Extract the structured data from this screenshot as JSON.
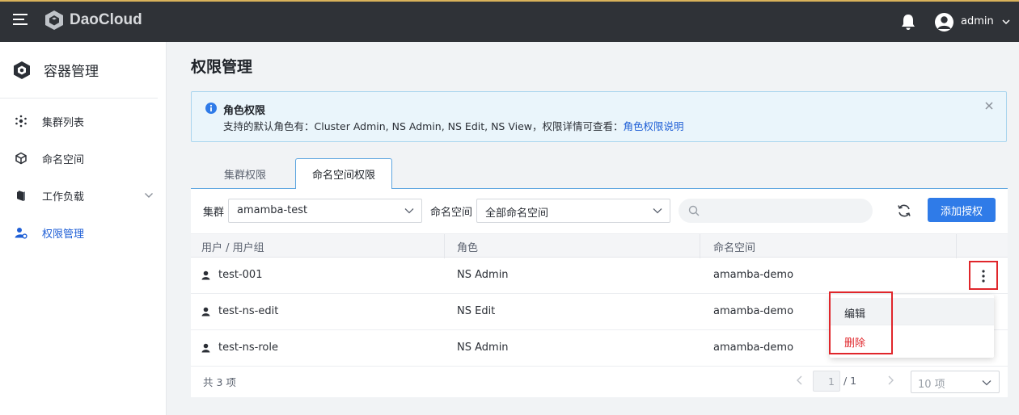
{
  "header": {
    "logo_text": "DaoCloud",
    "user_name": "admin"
  },
  "sidebar": {
    "title": "容器管理",
    "items": [
      {
        "label": "集群列表",
        "icon": "cluster-icon"
      },
      {
        "label": "命名空间",
        "icon": "namespace-cube-icon"
      },
      {
        "label": "工作负载",
        "icon": "workload-icon",
        "expandable": true
      },
      {
        "label": "权限管理",
        "icon": "user-settings-icon",
        "active": true
      }
    ]
  },
  "page": {
    "title": "权限管理"
  },
  "alert": {
    "title": "角色权限",
    "text": "支持的默认角色有：Cluster Admin, NS Admin, NS Edit, NS View，权限详情可查看：",
    "link": "角色权限说明"
  },
  "tabs": [
    {
      "label": "集群权限",
      "active": false
    },
    {
      "label": "命名空间权限",
      "active": true
    }
  ],
  "filters": {
    "cluster_label": "集群",
    "cluster_value": "amamba-test",
    "namespace_label": "命名空间",
    "namespace_value": "全部命名空间",
    "add_button": "添加授权"
  },
  "table": {
    "columns": [
      "用户 / 用户组",
      "角色",
      "命名空间"
    ],
    "rows": [
      {
        "user": "test-001",
        "role": "NS Admin",
        "namespace": "amamba-demo"
      },
      {
        "user": "test-ns-edit",
        "role": "NS Edit",
        "namespace": "amamba-demo"
      },
      {
        "user": "test-ns-role",
        "role": "NS Admin",
        "namespace": "amamba-demo"
      }
    ]
  },
  "footer": {
    "count": "共 3 项",
    "current_page": "1",
    "total_pages": "/ 1",
    "page_size": "10 项"
  },
  "menu": {
    "edit": "编辑",
    "delete": "删除"
  },
  "colors": {
    "primary": "#2f7be8",
    "danger": "#e0262b",
    "topbar": "#2f3237"
  }
}
